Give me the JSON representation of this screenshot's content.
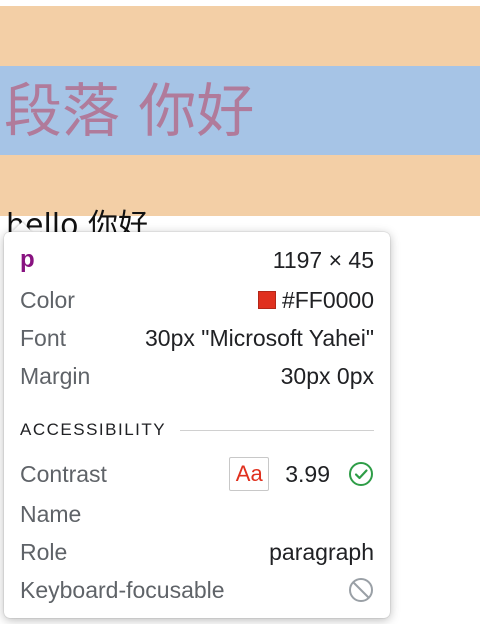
{
  "page": {
    "paragraph_text": "段落 你好",
    "under_text": "hello 你好"
  },
  "tooltip": {
    "tag": "p",
    "size": "1197 × 45",
    "color_label": "Color",
    "color_value": "#FF0000",
    "color_hex": "#E0301E",
    "font_label": "Font",
    "font_value": "30px \"Microsoft Yahei\"",
    "margin_label": "Margin",
    "margin_value": "30px 0px",
    "accessibility_header": "ACCESSIBILITY",
    "contrast_label": "Contrast",
    "contrast_sample": "Aa",
    "contrast_value": "3.99",
    "name_label": "Name",
    "name_value": "",
    "role_label": "Role",
    "role_value": "paragraph",
    "keyboard_label": "Keyboard-focusable",
    "contrast_icon": "check-circle-icon",
    "keyboard_icon": "not-allowed-icon"
  },
  "colors": {
    "margin_overlay": "#F3CFA6",
    "content_overlay": "#A6C4E6",
    "pass_green": "#2E9D47",
    "muted_gray": "#9AA0A6"
  }
}
